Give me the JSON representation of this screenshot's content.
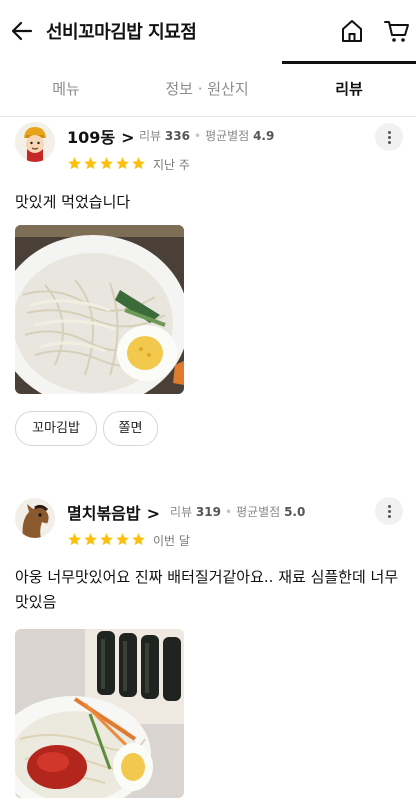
{
  "header": {
    "title": "선비꼬마김밥 지묘점",
    "back_icon": "arrow-left-icon",
    "home_icon": "home-icon",
    "cart_icon": "cart-icon"
  },
  "tabs": [
    {
      "label": "메뉴",
      "active": false
    },
    {
      "label": "정보 · 원산지",
      "active": false
    },
    {
      "label": "리뷰",
      "active": true
    }
  ],
  "reviews": [
    {
      "user": "109동",
      "review_label": "리뷰",
      "review_count": "336",
      "avg_label": "평균별점",
      "avg_rating": "4.9",
      "stars": 5,
      "date": "지난 주",
      "text": "맛있게 먹었습니다",
      "menu_tags": [
        "꼬마김밥",
        "쫄면"
      ]
    },
    {
      "user": "멸치볶음밥",
      "review_label": "리뷰",
      "review_count": "319",
      "avg_label": "평균별점",
      "avg_rating": "5.0",
      "stars": 5,
      "date": "이번 달",
      "text": "아웅 너무맛있어요 진짜 배터질거같아요.. 재료 심플한데 너무맛있음"
    }
  ],
  "colors": {
    "star": "#ffc107",
    "accent": "#111111"
  }
}
